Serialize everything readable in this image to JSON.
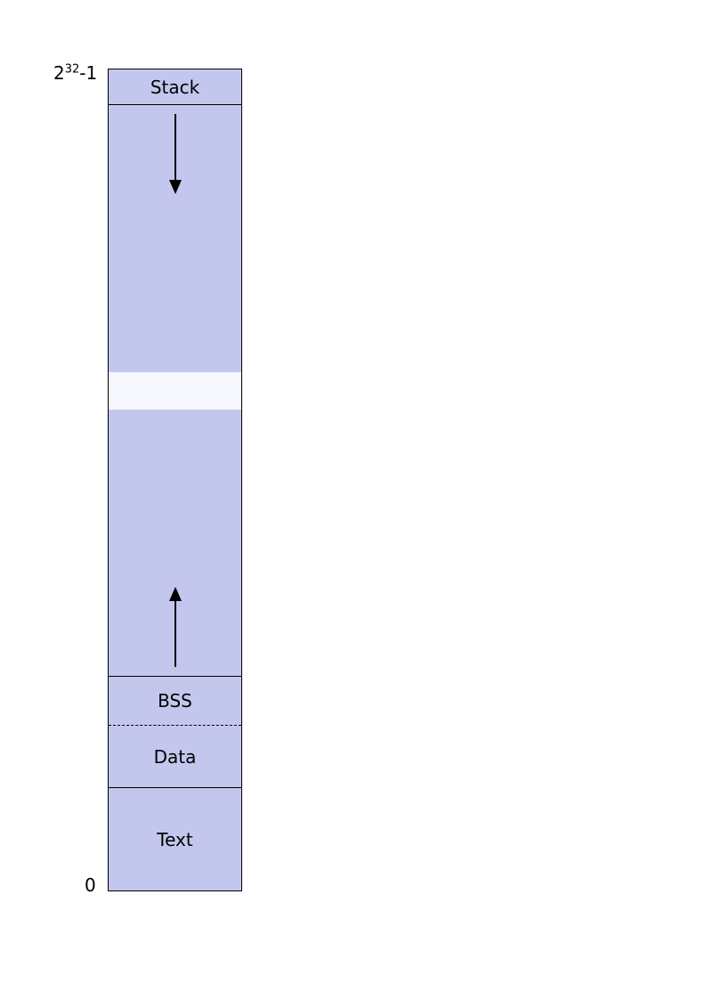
{
  "axis": {
    "top_label_html": "2<sup>32</sup>-1",
    "bottom_label": "0"
  },
  "segments": {
    "stack_label": "Stack",
    "bss_label": "BSS",
    "data_label": "Data",
    "text_label": "Text"
  },
  "layout_note": "Process virtual address space layout: Text at low addresses, then Data, BSS, heap growing upward; Stack at high addresses growing downward; gap in between.",
  "colors": {
    "segment_fill": "#c4c7ed",
    "gap_fill": "#f7f8fe",
    "border": "#000000"
  }
}
